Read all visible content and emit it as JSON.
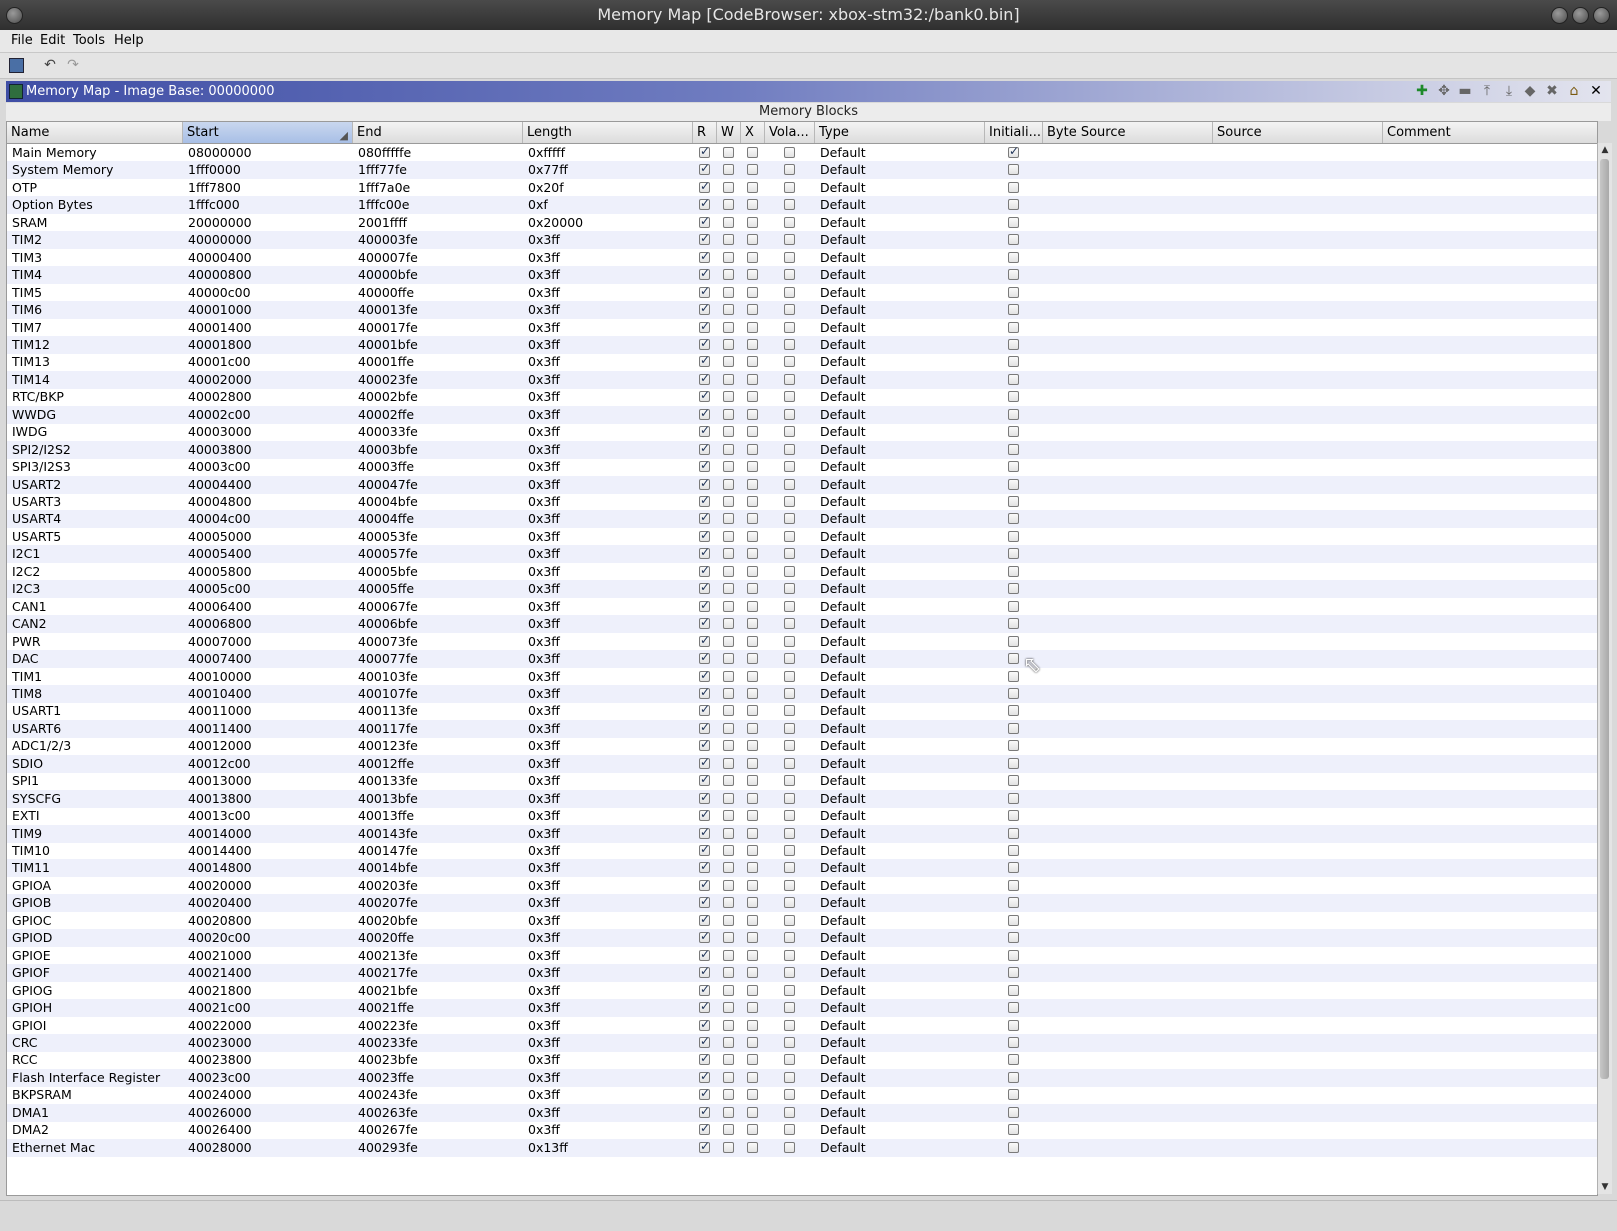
{
  "window": {
    "title": "Memory Map [CodeBrowser: xbox-stm32:/bank0.bin]"
  },
  "menu": [
    "File",
    "Edit",
    "Tools",
    "Help"
  ],
  "toolbar": {
    "icons": [
      "save-icon",
      "undo-icon",
      "redo-icon"
    ]
  },
  "panel": {
    "title": "Memory Map - Image Base: 00000000",
    "section": "Memory Blocks",
    "header_icons": [
      "add-block-icon",
      "move-block-icon",
      "split-block-icon",
      "expand-up-icon",
      "expand-down-icon",
      "merge-blocks-icon",
      "delete-block-icon",
      "set-image-base-icon",
      "close-icon"
    ]
  },
  "columns": [
    "Name",
    "Start",
    "End",
    "Length",
    "R",
    "W",
    "X",
    "Vola...",
    "Type",
    "Initiali...",
    "Byte Source",
    "Source",
    "Comment"
  ],
  "sorted_column": "Start",
  "rows": [
    {
      "name": "Main Memory",
      "start": "08000000",
      "end": "080fffffe",
      "length": "0xfffff",
      "r": true,
      "w": false,
      "x": false,
      "vol": false,
      "type": "Default",
      "init": true
    },
    {
      "name": "System Memory",
      "start": "1fff0000",
      "end": "1fff77fe",
      "length": "0x77ff",
      "r": true,
      "w": false,
      "x": false,
      "vol": false,
      "type": "Default",
      "init": false
    },
    {
      "name": "OTP",
      "start": "1fff7800",
      "end": "1fff7a0e",
      "length": "0x20f",
      "r": true,
      "w": false,
      "x": false,
      "vol": false,
      "type": "Default",
      "init": false
    },
    {
      "name": "Option Bytes",
      "start": "1fffc000",
      "end": "1fffc00e",
      "length": "0xf",
      "r": true,
      "w": false,
      "x": false,
      "vol": false,
      "type": "Default",
      "init": false
    },
    {
      "name": "SRAM",
      "start": "20000000",
      "end": "2001ffff",
      "length": "0x20000",
      "r": true,
      "w": false,
      "x": false,
      "vol": false,
      "type": "Default",
      "init": false
    },
    {
      "name": "TIM2",
      "start": "40000000",
      "end": "400003fe",
      "length": "0x3ff",
      "r": true,
      "w": false,
      "x": false,
      "vol": false,
      "type": "Default",
      "init": false
    },
    {
      "name": "TIM3",
      "start": "40000400",
      "end": "400007fe",
      "length": "0x3ff",
      "r": true,
      "w": false,
      "x": false,
      "vol": false,
      "type": "Default",
      "init": false
    },
    {
      "name": "TIM4",
      "start": "40000800",
      "end": "40000bfe",
      "length": "0x3ff",
      "r": true,
      "w": false,
      "x": false,
      "vol": false,
      "type": "Default",
      "init": false
    },
    {
      "name": "TIM5",
      "start": "40000c00",
      "end": "40000ffe",
      "length": "0x3ff",
      "r": true,
      "w": false,
      "x": false,
      "vol": false,
      "type": "Default",
      "init": false
    },
    {
      "name": "TIM6",
      "start": "40001000",
      "end": "400013fe",
      "length": "0x3ff",
      "r": true,
      "w": false,
      "x": false,
      "vol": false,
      "type": "Default",
      "init": false
    },
    {
      "name": "TIM7",
      "start": "40001400",
      "end": "400017fe",
      "length": "0x3ff",
      "r": true,
      "w": false,
      "x": false,
      "vol": false,
      "type": "Default",
      "init": false
    },
    {
      "name": "TIM12",
      "start": "40001800",
      "end": "40001bfe",
      "length": "0x3ff",
      "r": true,
      "w": false,
      "x": false,
      "vol": false,
      "type": "Default",
      "init": false
    },
    {
      "name": "TIM13",
      "start": "40001c00",
      "end": "40001ffe",
      "length": "0x3ff",
      "r": true,
      "w": false,
      "x": false,
      "vol": false,
      "type": "Default",
      "init": false
    },
    {
      "name": "TIM14",
      "start": "40002000",
      "end": "400023fe",
      "length": "0x3ff",
      "r": true,
      "w": false,
      "x": false,
      "vol": false,
      "type": "Default",
      "init": false
    },
    {
      "name": "RTC/BKP",
      "start": "40002800",
      "end": "40002bfe",
      "length": "0x3ff",
      "r": true,
      "w": false,
      "x": false,
      "vol": false,
      "type": "Default",
      "init": false
    },
    {
      "name": "WWDG",
      "start": "40002c00",
      "end": "40002ffe",
      "length": "0x3ff",
      "r": true,
      "w": false,
      "x": false,
      "vol": false,
      "type": "Default",
      "init": false
    },
    {
      "name": "IWDG",
      "start": "40003000",
      "end": "400033fe",
      "length": "0x3ff",
      "r": true,
      "w": false,
      "x": false,
      "vol": false,
      "type": "Default",
      "init": false
    },
    {
      "name": "SPI2/I2S2",
      "start": "40003800",
      "end": "40003bfe",
      "length": "0x3ff",
      "r": true,
      "w": false,
      "x": false,
      "vol": false,
      "type": "Default",
      "init": false
    },
    {
      "name": "SPI3/I2S3",
      "start": "40003c00",
      "end": "40003ffe",
      "length": "0x3ff",
      "r": true,
      "w": false,
      "x": false,
      "vol": false,
      "type": "Default",
      "init": false
    },
    {
      "name": "USART2",
      "start": "40004400",
      "end": "400047fe",
      "length": "0x3ff",
      "r": true,
      "w": false,
      "x": false,
      "vol": false,
      "type": "Default",
      "init": false
    },
    {
      "name": "USART3",
      "start": "40004800",
      "end": "40004bfe",
      "length": "0x3ff",
      "r": true,
      "w": false,
      "x": false,
      "vol": false,
      "type": "Default",
      "init": false
    },
    {
      "name": "USART4",
      "start": "40004c00",
      "end": "40004ffe",
      "length": "0x3ff",
      "r": true,
      "w": false,
      "x": false,
      "vol": false,
      "type": "Default",
      "init": false
    },
    {
      "name": "USART5",
      "start": "40005000",
      "end": "400053fe",
      "length": "0x3ff",
      "r": true,
      "w": false,
      "x": false,
      "vol": false,
      "type": "Default",
      "init": false
    },
    {
      "name": "I2C1",
      "start": "40005400",
      "end": "400057fe",
      "length": "0x3ff",
      "r": true,
      "w": false,
      "x": false,
      "vol": false,
      "type": "Default",
      "init": false
    },
    {
      "name": "I2C2",
      "start": "40005800",
      "end": "40005bfe",
      "length": "0x3ff",
      "r": true,
      "w": false,
      "x": false,
      "vol": false,
      "type": "Default",
      "init": false
    },
    {
      "name": "I2C3",
      "start": "40005c00",
      "end": "40005ffe",
      "length": "0x3ff",
      "r": true,
      "w": false,
      "x": false,
      "vol": false,
      "type": "Default",
      "init": false
    },
    {
      "name": "CAN1",
      "start": "40006400",
      "end": "400067fe",
      "length": "0x3ff",
      "r": true,
      "w": false,
      "x": false,
      "vol": false,
      "type": "Default",
      "init": false
    },
    {
      "name": "CAN2",
      "start": "40006800",
      "end": "40006bfe",
      "length": "0x3ff",
      "r": true,
      "w": false,
      "x": false,
      "vol": false,
      "type": "Default",
      "init": false
    },
    {
      "name": "PWR",
      "start": "40007000",
      "end": "400073fe",
      "length": "0x3ff",
      "r": true,
      "w": false,
      "x": false,
      "vol": false,
      "type": "Default",
      "init": false
    },
    {
      "name": "DAC",
      "start": "40007400",
      "end": "400077fe",
      "length": "0x3ff",
      "r": true,
      "w": false,
      "x": false,
      "vol": false,
      "type": "Default",
      "init": false
    },
    {
      "name": "TIM1",
      "start": "40010000",
      "end": "400103fe",
      "length": "0x3ff",
      "r": true,
      "w": false,
      "x": false,
      "vol": false,
      "type": "Default",
      "init": false
    },
    {
      "name": "TIM8",
      "start": "40010400",
      "end": "400107fe",
      "length": "0x3ff",
      "r": true,
      "w": false,
      "x": false,
      "vol": false,
      "type": "Default",
      "init": false
    },
    {
      "name": "USART1",
      "start": "40011000",
      "end": "400113fe",
      "length": "0x3ff",
      "r": true,
      "w": false,
      "x": false,
      "vol": false,
      "type": "Default",
      "init": false
    },
    {
      "name": "USART6",
      "start": "40011400",
      "end": "400117fe",
      "length": "0x3ff",
      "r": true,
      "w": false,
      "x": false,
      "vol": false,
      "type": "Default",
      "init": false
    },
    {
      "name": "ADC1/2/3",
      "start": "40012000",
      "end": "400123fe",
      "length": "0x3ff",
      "r": true,
      "w": false,
      "x": false,
      "vol": false,
      "type": "Default",
      "init": false
    },
    {
      "name": "SDIO",
      "start": "40012c00",
      "end": "40012ffe",
      "length": "0x3ff",
      "r": true,
      "w": false,
      "x": false,
      "vol": false,
      "type": "Default",
      "init": false
    },
    {
      "name": "SPI1",
      "start": "40013000",
      "end": "400133fe",
      "length": "0x3ff",
      "r": true,
      "w": false,
      "x": false,
      "vol": false,
      "type": "Default",
      "init": false
    },
    {
      "name": "SYSCFG",
      "start": "40013800",
      "end": "40013bfe",
      "length": "0x3ff",
      "r": true,
      "w": false,
      "x": false,
      "vol": false,
      "type": "Default",
      "init": false
    },
    {
      "name": "EXTI",
      "start": "40013c00",
      "end": "40013ffe",
      "length": "0x3ff",
      "r": true,
      "w": false,
      "x": false,
      "vol": false,
      "type": "Default",
      "init": false
    },
    {
      "name": "TIM9",
      "start": "40014000",
      "end": "400143fe",
      "length": "0x3ff",
      "r": true,
      "w": false,
      "x": false,
      "vol": false,
      "type": "Default",
      "init": false
    },
    {
      "name": "TIM10",
      "start": "40014400",
      "end": "400147fe",
      "length": "0x3ff",
      "r": true,
      "w": false,
      "x": false,
      "vol": false,
      "type": "Default",
      "init": false
    },
    {
      "name": "TIM11",
      "start": "40014800",
      "end": "40014bfe",
      "length": "0x3ff",
      "r": true,
      "w": false,
      "x": false,
      "vol": false,
      "type": "Default",
      "init": false
    },
    {
      "name": "GPIOA",
      "start": "40020000",
      "end": "400203fe",
      "length": "0x3ff",
      "r": true,
      "w": false,
      "x": false,
      "vol": false,
      "type": "Default",
      "init": false
    },
    {
      "name": "GPIOB",
      "start": "40020400",
      "end": "400207fe",
      "length": "0x3ff",
      "r": true,
      "w": false,
      "x": false,
      "vol": false,
      "type": "Default",
      "init": false
    },
    {
      "name": "GPIOC",
      "start": "40020800",
      "end": "40020bfe",
      "length": "0x3ff",
      "r": true,
      "w": false,
      "x": false,
      "vol": false,
      "type": "Default",
      "init": false
    },
    {
      "name": "GPIOD",
      "start": "40020c00",
      "end": "40020ffe",
      "length": "0x3ff",
      "r": true,
      "w": false,
      "x": false,
      "vol": false,
      "type": "Default",
      "init": false
    },
    {
      "name": "GPIOE",
      "start": "40021000",
      "end": "400213fe",
      "length": "0x3ff",
      "r": true,
      "w": false,
      "x": false,
      "vol": false,
      "type": "Default",
      "init": false
    },
    {
      "name": "GPIOF",
      "start": "40021400",
      "end": "400217fe",
      "length": "0x3ff",
      "r": true,
      "w": false,
      "x": false,
      "vol": false,
      "type": "Default",
      "init": false
    },
    {
      "name": "GPIOG",
      "start": "40021800",
      "end": "40021bfe",
      "length": "0x3ff",
      "r": true,
      "w": false,
      "x": false,
      "vol": false,
      "type": "Default",
      "init": false
    },
    {
      "name": "GPIOH",
      "start": "40021c00",
      "end": "40021ffe",
      "length": "0x3ff",
      "r": true,
      "w": false,
      "x": false,
      "vol": false,
      "type": "Default",
      "init": false
    },
    {
      "name": "GPIOI",
      "start": "40022000",
      "end": "400223fe",
      "length": "0x3ff",
      "r": true,
      "w": false,
      "x": false,
      "vol": false,
      "type": "Default",
      "init": false
    },
    {
      "name": "CRC",
      "start": "40023000",
      "end": "400233fe",
      "length": "0x3ff",
      "r": true,
      "w": false,
      "x": false,
      "vol": false,
      "type": "Default",
      "init": false
    },
    {
      "name": "RCC",
      "start": "40023800",
      "end": "40023bfe",
      "length": "0x3ff",
      "r": true,
      "w": false,
      "x": false,
      "vol": false,
      "type": "Default",
      "init": false
    },
    {
      "name": "Flash Interface Register",
      "start": "40023c00",
      "end": "40023ffe",
      "length": "0x3ff",
      "r": true,
      "w": false,
      "x": false,
      "vol": false,
      "type": "Default",
      "init": false
    },
    {
      "name": "BKPSRAM",
      "start": "40024000",
      "end": "400243fe",
      "length": "0x3ff",
      "r": true,
      "w": false,
      "x": false,
      "vol": false,
      "type": "Default",
      "init": false
    },
    {
      "name": "DMA1",
      "start": "40026000",
      "end": "400263fe",
      "length": "0x3ff",
      "r": true,
      "w": false,
      "x": false,
      "vol": false,
      "type": "Default",
      "init": false
    },
    {
      "name": "DMA2",
      "start": "40026400",
      "end": "400267fe",
      "length": "0x3ff",
      "r": true,
      "w": false,
      "x": false,
      "vol": false,
      "type": "Default",
      "init": false
    },
    {
      "name": "Ethernet Mac",
      "start": "40028000",
      "end": "400293fe",
      "length": "0x13ff",
      "r": true,
      "w": false,
      "x": false,
      "vol": false,
      "type": "Default",
      "init": false
    }
  ]
}
